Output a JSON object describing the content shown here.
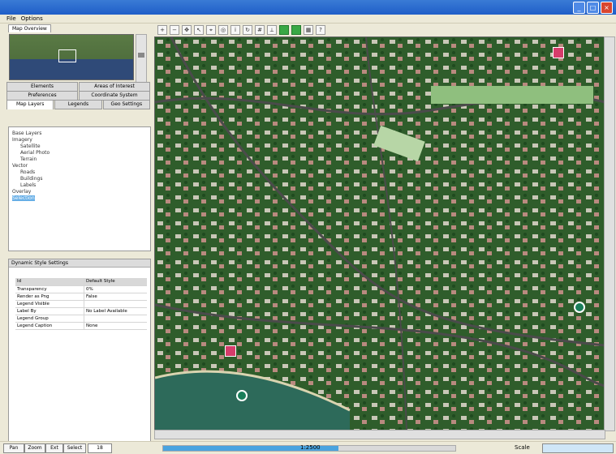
{
  "app": {
    "title": "",
    "menu": [
      "File",
      "Options"
    ]
  },
  "toolbar": {
    "buttons": [
      "zoom-in",
      "zoom-out",
      "pan",
      "select",
      "measure",
      "locate",
      "info",
      "rotate",
      "grid",
      "layers-green",
      "layers-green-2",
      "overview-toggle",
      "help"
    ]
  },
  "left_panel": {
    "top_tab": "Map Overview",
    "mid_tabs_row1": [
      "Elements",
      "Areas of Interest"
    ],
    "mid_tabs_row2": [
      "Preferences",
      "Coordinate System"
    ],
    "mid_tabs_row3": [
      "Map Layers",
      "Legends",
      "Geo Settings"
    ],
    "tree": [
      {
        "label": "Base Layers",
        "depth": 0
      },
      {
        "label": "Imagery",
        "depth": 0
      },
      {
        "label": "Satellite",
        "depth": 1
      },
      {
        "label": "Aerial Photo",
        "depth": 1
      },
      {
        "label": "Terrain",
        "depth": 1
      },
      {
        "label": "Vector",
        "depth": 0
      },
      {
        "label": "Roads",
        "depth": 1
      },
      {
        "label": "Buildings",
        "depth": 1
      },
      {
        "label": "Labels",
        "depth": 1
      },
      {
        "label": "Overlay",
        "depth": 0
      },
      {
        "label": "Selection",
        "depth": 0,
        "selected": true
      }
    ],
    "properties": {
      "title": "Dynamic Style Settings",
      "header": {
        "key": "Id",
        "value": "Default Style"
      },
      "rows": [
        {
          "key": "Transparency",
          "value": "0%"
        },
        {
          "key": "Render as Png",
          "value": "False"
        },
        {
          "key": "Legend Visible",
          "value": ""
        },
        {
          "key": "Label By",
          "value": "No Label Available"
        },
        {
          "key": "Legend Group",
          "value": ""
        },
        {
          "key": "Legend Caption",
          "value": "None"
        }
      ]
    }
  },
  "status_bar": {
    "buttons": [
      "Pan",
      "Zoom",
      "Ext",
      "Select"
    ],
    "zoom_value": "18",
    "progress": 0.6,
    "scale": "1:2500",
    "right_label": "Scale"
  },
  "colors": {
    "title_bar": "#1f5ec8",
    "map_green": "#2d5a2a",
    "water": "#2f4a78",
    "selection": "#66aee6",
    "poi": "#1a7e5a",
    "pin": "#d63c6b"
  }
}
